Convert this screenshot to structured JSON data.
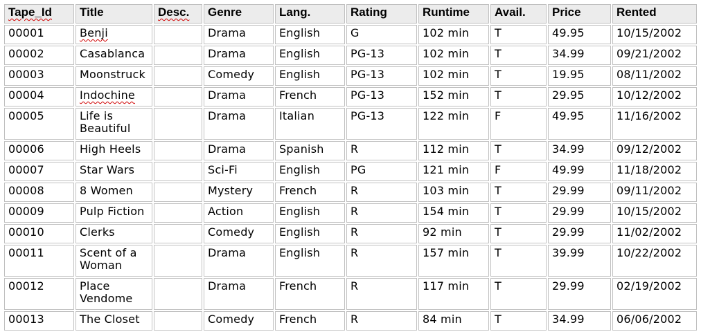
{
  "table": {
    "headers": [
      "Tape_Id",
      "Title",
      "Desc.",
      "Genre",
      "Lang.",
      "Rating",
      "Runtime",
      "Avail.",
      "Price",
      "Rented"
    ],
    "rows": [
      [
        "00001",
        "Benji",
        "",
        "Drama",
        "English",
        "G",
        "102 min",
        "T",
        "49.95",
        "10/15/2002"
      ],
      [
        "00002",
        "Casablanca",
        "",
        "Drama",
        "English",
        "PG-13",
        "102 min",
        "T",
        "34.99",
        "09/21/2002"
      ],
      [
        "00003",
        "Moonstruck",
        "",
        "Comedy",
        "English",
        "PG-13",
        "102 min",
        "T",
        "19.95",
        "08/11/2002"
      ],
      [
        "00004",
        "Indochine",
        "",
        "Drama",
        "French",
        "PG-13",
        "152 min",
        "T",
        "29.95",
        "10/12/2002"
      ],
      [
        "00005",
        "Life is Beautiful",
        "",
        "Drama",
        "Italian",
        "PG-13",
        "122 min",
        "F",
        "49.95",
        "11/16/2002"
      ],
      [
        "00006",
        "High Heels",
        "",
        "Drama",
        "Spanish",
        "R",
        "112 min",
        "T",
        "34.99",
        "09/12/2002"
      ],
      [
        "00007",
        "Star Wars",
        "",
        "Sci-Fi",
        "English",
        "PG",
        "121 min",
        "F",
        "49.99",
        "11/18/2002"
      ],
      [
        "00008",
        "8 Women",
        "",
        "Mystery",
        "French",
        "R",
        "103 min",
        "T",
        "29.99",
        "09/11/2002"
      ],
      [
        "00009",
        "Pulp Fiction",
        "",
        "Action",
        "English",
        "R",
        "154 min",
        "T",
        "29.99",
        "10/15/2002"
      ],
      [
        "00010",
        "Clerks",
        "",
        "Comedy",
        "English",
        "R",
        "92 min",
        "T",
        "29.99",
        "11/02/2002"
      ],
      [
        "00011",
        "Scent of a Woman",
        "",
        "Drama",
        "English",
        "R",
        "157 min",
        "T",
        "39.99",
        "10/22/2002"
      ],
      [
        "00012",
        "Place Vendome",
        "",
        "Drama",
        "French",
        "R",
        "117 min",
        "T",
        "29.99",
        "02/19/2002"
      ],
      [
        "00013",
        "The Closet",
        "",
        "Comedy",
        "French",
        "R",
        "84 min",
        "T",
        "34.99",
        "06/06/2002"
      ]
    ]
  }
}
